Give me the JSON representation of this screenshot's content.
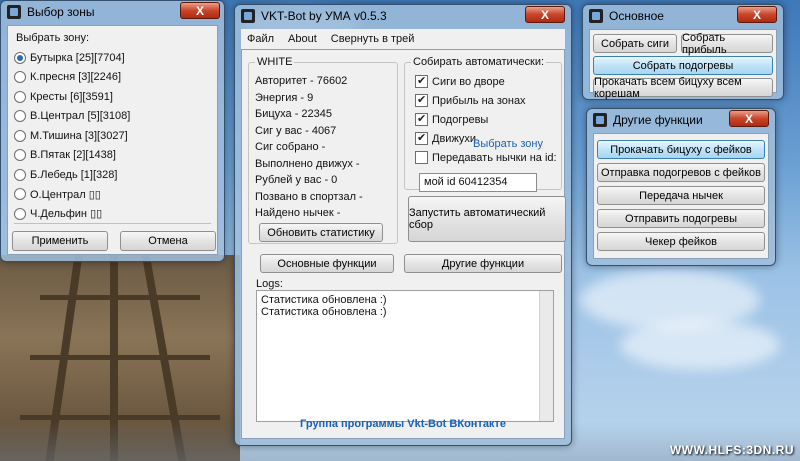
{
  "watermark": "WWW.HLFS:3DN.RU",
  "zone_window": {
    "title": "Выбор зоны",
    "close": "X",
    "legend": "Выбрать зону:",
    "zones": [
      {
        "label": "Бутырка [25][7704]",
        "selected": true
      },
      {
        "label": "К.пресня [3][2246]",
        "selected": false
      },
      {
        "label": "Кресты [6][3591]",
        "selected": false
      },
      {
        "label": "В.Централ [5][3108]",
        "selected": false
      },
      {
        "label": "М.Тишина [3][3027]",
        "selected": false
      },
      {
        "label": "В.Пятак [2][1438]",
        "selected": false
      },
      {
        "label": "Б.Лебедь [1][328]",
        "selected": false
      },
      {
        "label": "О.Централ ▯▯",
        "selected": false
      },
      {
        "label": "Ч.Дельфин ▯▯",
        "selected": false
      }
    ],
    "apply": "Применить",
    "cancel": "Отмена"
  },
  "main_window": {
    "title": "VKT-Bot by УМА v0.5.3",
    "close": "X",
    "menu": [
      "Файл",
      "About",
      "Свернуть в трей"
    ],
    "stats_group_title": "WHITE",
    "stats": [
      "Авторитет - 76602",
      "Энергия - 9",
      "Бицуха - 22345",
      "Сиг у вас - 4067",
      "Сиг собрано  -",
      "Выполнено движух -",
      "Рублей у вас - 0",
      "Позвано в спортзал -",
      "Найдено нычек -"
    ],
    "refresh_stats": "Обновить статистику",
    "auto_group_title": "Собирать автоматически:",
    "auto_options": [
      {
        "label": "Сиги во дворе",
        "checked": true
      },
      {
        "label": "Прибыль на зонах",
        "checked": true
      },
      {
        "label": "Подогревы",
        "checked": true
      },
      {
        "label": "Движухи",
        "checked": true
      },
      {
        "label": "Передавать нычки на id:",
        "checked": false
      }
    ],
    "choose_zone_link": "Выбрать зону",
    "id_input_value": "мой id 60412354",
    "start_auto": "Запустить автоматический сбор",
    "basic_functions": "Основные функции",
    "other_functions": "Другие функции",
    "logs_label": "Logs:",
    "logs": [
      "Статистика обновлена :)",
      "Статистика обновлена :)"
    ],
    "footer": "Группа программы Vkt-Bot ВКонтакте"
  },
  "basic_window": {
    "title": "Основное",
    "close": "X",
    "collect_cigs": "Собрать сиги",
    "collect_profit": "Собрать прибыль",
    "collect_heat": "Собрать подогревы",
    "pump_all": "Прокачать всем бицуху всем корешам"
  },
  "other_window": {
    "title": "Другие функции",
    "close": "X",
    "buttons": [
      "Прокачать бицуху с фейков",
      "Отправка подогревов с фейков",
      "Передача нычек",
      "Отправить подогревы",
      "Чекер фейков"
    ]
  }
}
